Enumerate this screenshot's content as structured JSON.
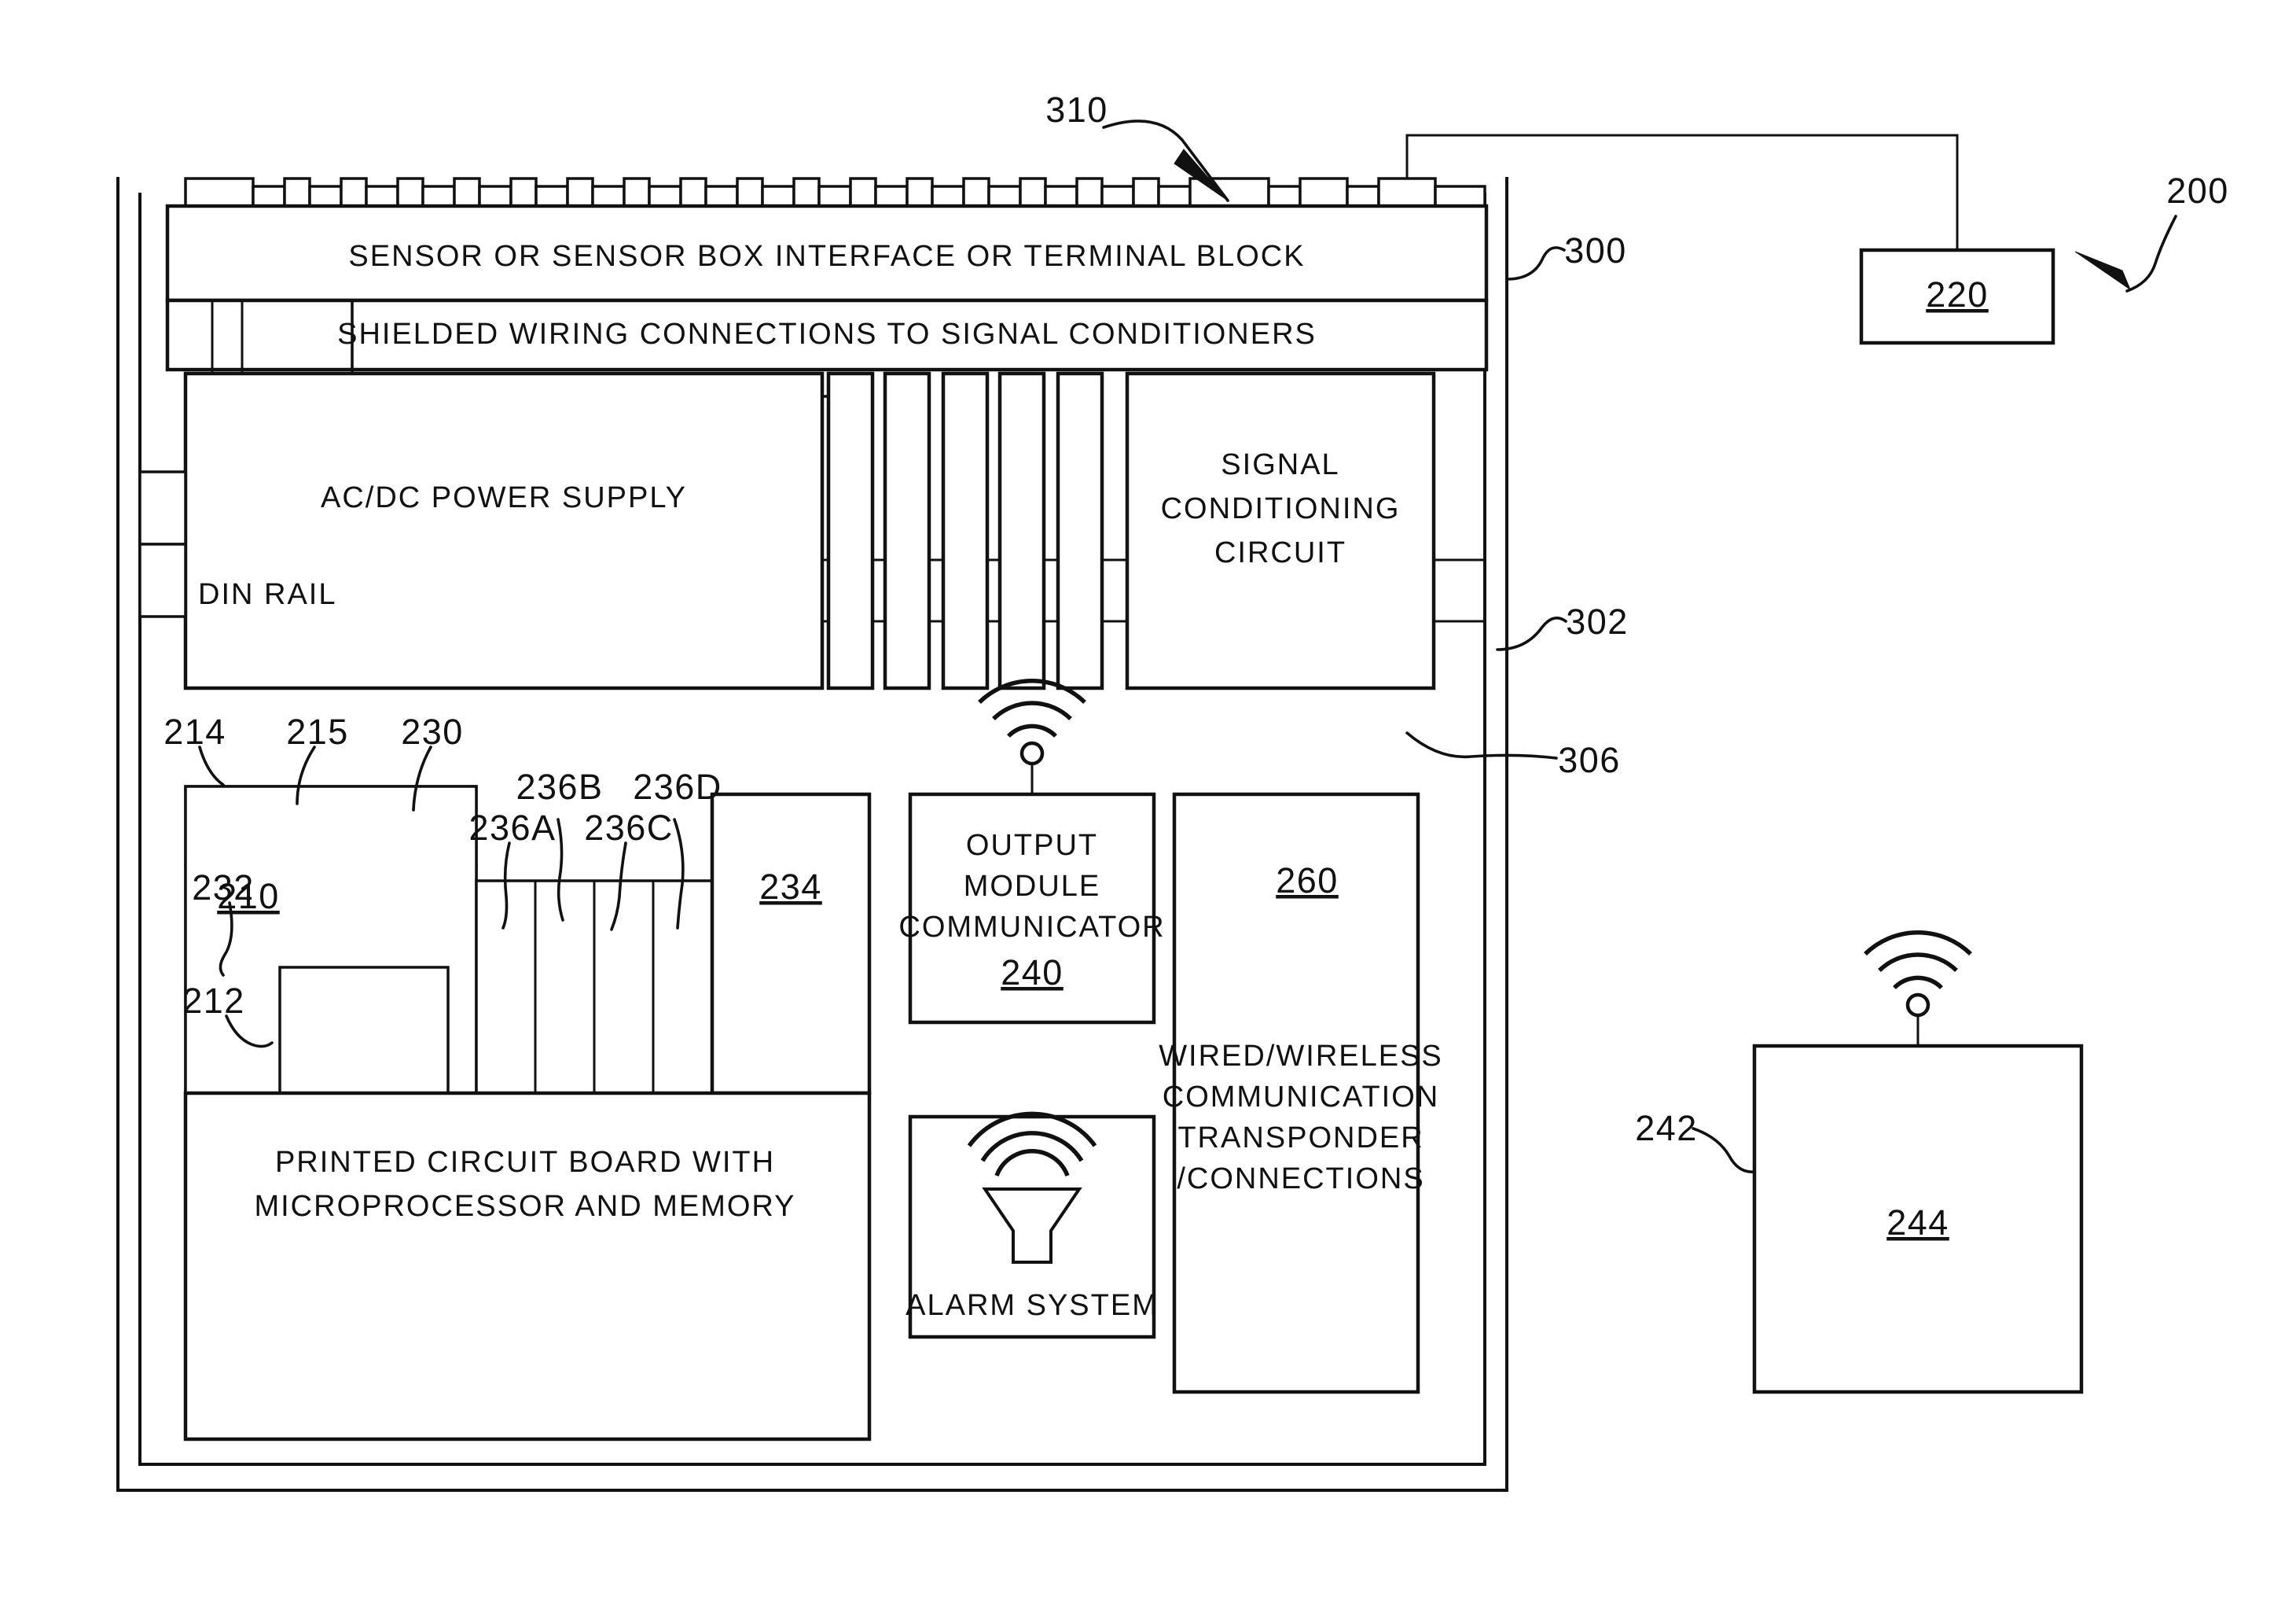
{
  "figure": {
    "type": "patent-block-diagram",
    "description": "Sensor enclosure block diagram with terminal block, power supply, signal conditioning, microprocessor board and communications"
  },
  "blocks": {
    "terminal_block": {
      "label": "SENSOR OR SENSOR BOX INTERFACE OR TERMINAL BLOCK"
    },
    "shielded_wiring": {
      "label": "SHIELDED WIRING CONNECTIONS TO SIGNAL CONDITIONERS"
    },
    "power_supply": {
      "label": "AC/DC POWER SUPPLY"
    },
    "din_rail": {
      "label": "DIN RAIL"
    },
    "signal_conditioning": {
      "line1": "SIGNAL",
      "line2": "CONDITIONING",
      "line3": "CIRCUIT"
    },
    "pcb": {
      "line1": "PRINTED CIRCUIT BOARD WITH",
      "line2": "MICROPROCESSOR AND MEMORY"
    },
    "output_module": {
      "line1": "OUTPUT",
      "line2": "MODULE",
      "line3": "COMMUNICATOR",
      "ref": "240"
    },
    "alarm": {
      "label": "ALARM SYSTEM"
    },
    "transponder": {
      "ref": "260",
      "line1": "WIRED/WIRELESS",
      "line2": "COMMUNICATION",
      "line3": "TRANSPONDER",
      "line4": "/CONNECTIONS"
    },
    "remote_220": {
      "ref": "220"
    },
    "remote_244": {
      "ref": "244"
    },
    "board_234": {
      "ref": "234"
    },
    "board_210": {
      "ref": "210"
    }
  },
  "refs": {
    "r200": "200",
    "r210": "210",
    "r212": "212",
    "r214": "214",
    "r215": "215",
    "r220": "220",
    "r230": "230",
    "r232": "232",
    "r234": "234",
    "r236a": "236A",
    "r236b": "236B",
    "r236c": "236C",
    "r236d": "236D",
    "r240": "240",
    "r242": "242",
    "r244": "244",
    "r260": "260",
    "r300": "300",
    "r302": "302",
    "r306": "306",
    "r310": "310"
  },
  "icons": {
    "wifi_output": "wifi-signal-icon",
    "wifi_remote": "wifi-signal-icon",
    "alarm_horn": "alarm-horn-icon"
  },
  "colors": {
    "line": "#111111",
    "background": "#ffffff"
  }
}
